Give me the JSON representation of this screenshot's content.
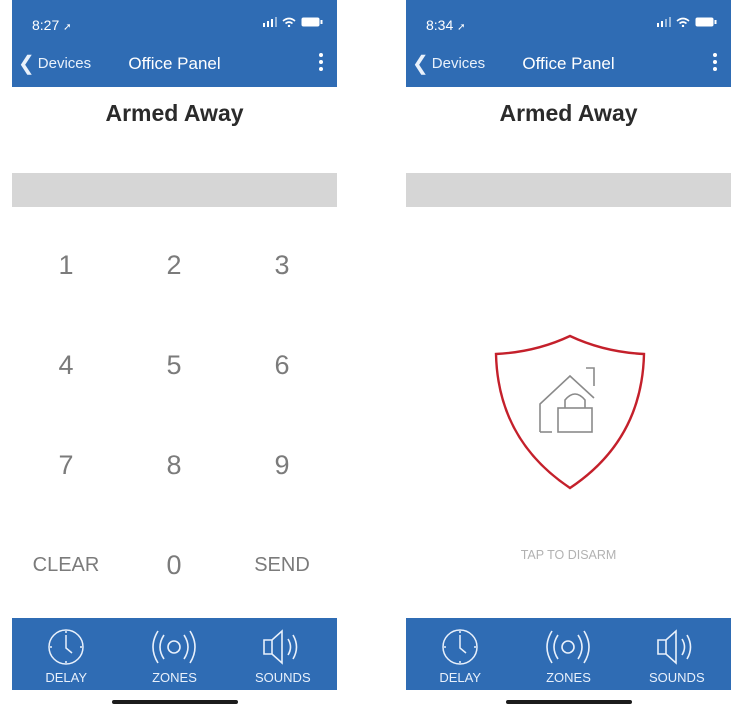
{
  "screens": [
    {
      "time": "8:27",
      "nav": {
        "back_label": "Devices",
        "title": "Office Panel"
      },
      "status_title": "Armed Away",
      "keypad": {
        "keys": [
          "1",
          "2",
          "3",
          "4",
          "5",
          "6",
          "7",
          "8",
          "9",
          "CLEAR",
          "0",
          "SEND"
        ]
      },
      "toolbar": {
        "delay_label": "DELAY",
        "zones_label": "ZONES",
        "sounds_label": "SOUNDS"
      }
    },
    {
      "time": "8:34",
      "nav": {
        "back_label": "Devices",
        "title": "Office Panel"
      },
      "status_title": "Armed Away",
      "disarm_label": "TAP TO DISARM",
      "toolbar": {
        "delay_label": "DELAY",
        "zones_label": "ZONES",
        "sounds_label": "SOUNDS"
      }
    }
  ],
  "colors": {
    "accent": "#2f6cb4",
    "shield": "#c4202b",
    "entry_bar": "#d6d6d6",
    "key_text": "#7b7b7b"
  },
  "icons": [
    "location-arrow-icon",
    "signal-icon",
    "wifi-icon",
    "battery-icon",
    "chevron-left-icon",
    "more-vertical-icon",
    "clock-icon",
    "broadcast-icon",
    "speaker-icon",
    "shield-home-lock-icon"
  ]
}
